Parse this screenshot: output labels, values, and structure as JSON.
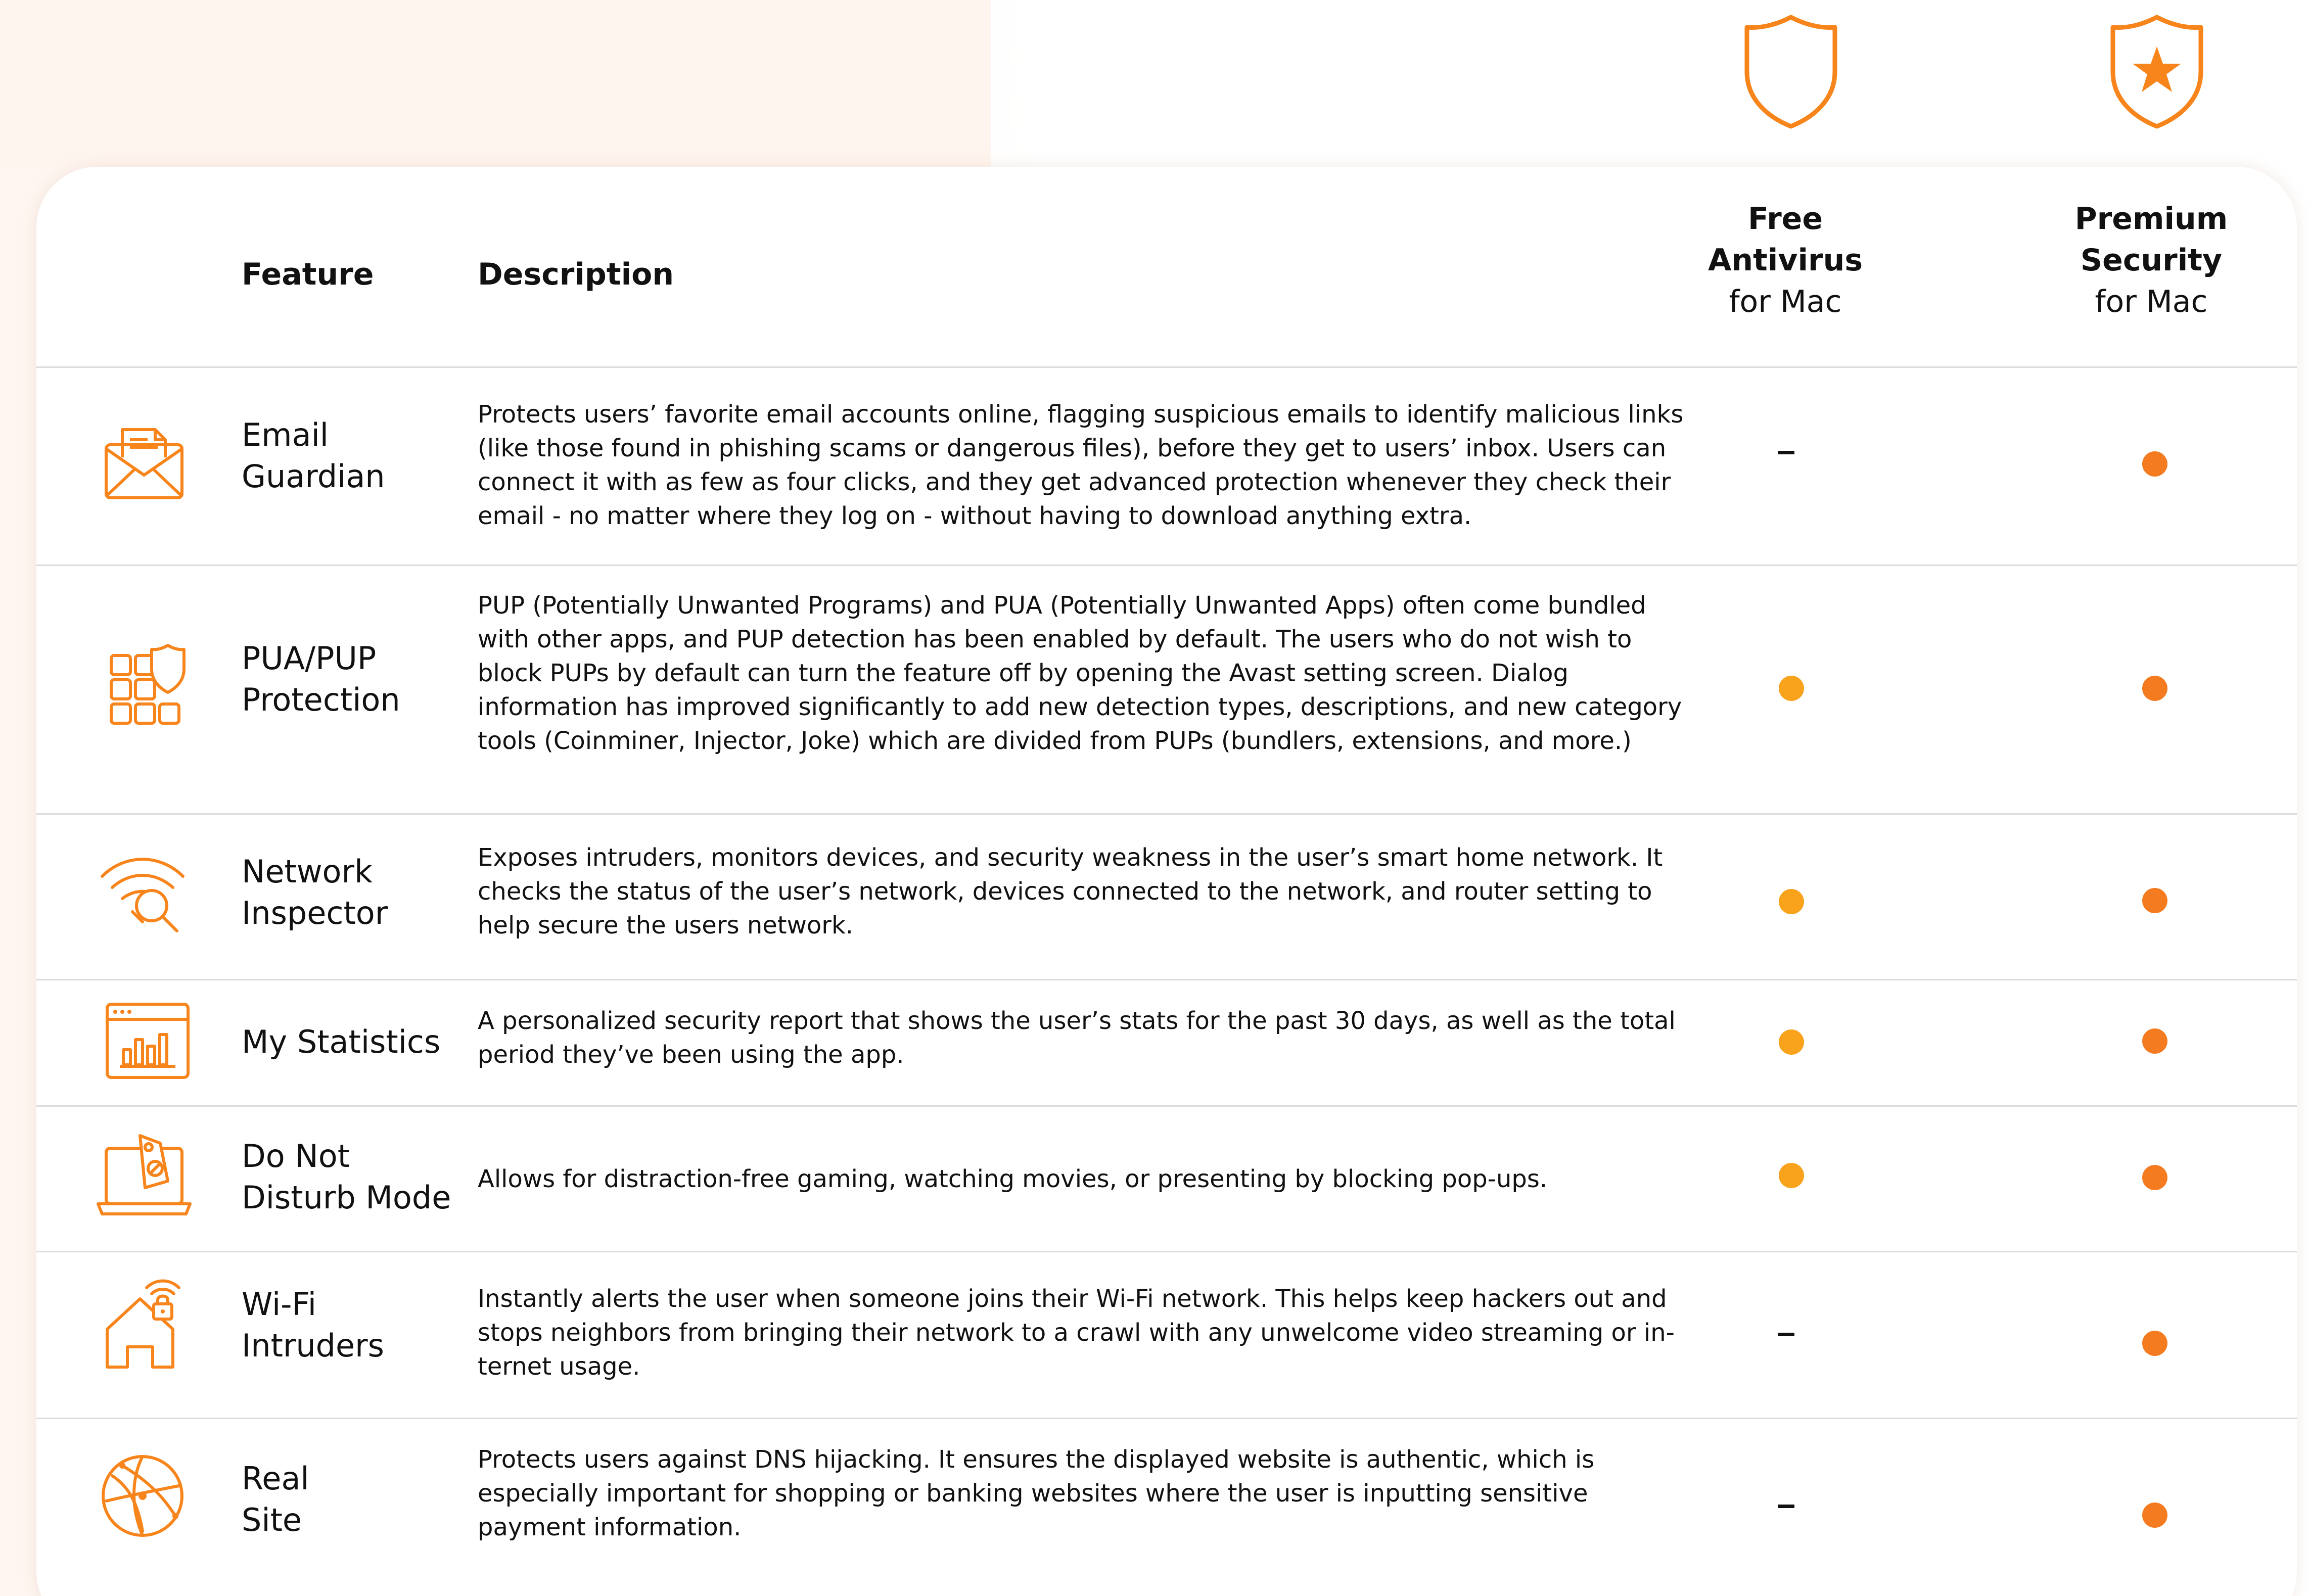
{
  "colors": {
    "accent": "#f7851b",
    "free_dot": "#f9a21c",
    "premium_dot": "#f47b20",
    "text": "#111111",
    "divider": "#dcdcdc"
  },
  "plans": [
    {
      "icon": "shield-icon",
      "name_bold_1": "Free",
      "name_bold_2": "Antivirus",
      "suffix": "for Mac"
    },
    {
      "icon": "shield-star-icon",
      "name_bold_1": "Premium",
      "name_bold_2": "Security",
      "suffix": "for Mac"
    }
  ],
  "header": {
    "feature": "Feature",
    "description": "Description"
  },
  "rows": [
    {
      "icon": "envelope-icon",
      "name_line1": "Email",
      "name_line2": "Guardian",
      "description": "Protects users’ favorite email accounts online, flagging suspicious emails to identify malicious links (like those found in phishing scams or dangerous files), before they get to users’ inbox. Users can connect it with as few as four clicks, and they get advanced protection whenever they check their email - no matter where they log on - without having to download anything extra.",
      "free": "–",
      "premium": "dot"
    },
    {
      "icon": "app-grid-shield-icon",
      "name_line1": "PUA/PUP",
      "name_line2": "Protection",
      "description": "PUP (Potentially Unwanted Programs) and PUA (Potentially Unwanted Apps) often come bundled with other apps, and PUP detection has been enabled by default. The users who do not wish to block PUPs by default can turn the feature off by opening the Avast setting screen. Dialog information has improved significantly to add new detection types, descriptions, and new category tools (Coinminer, Injector, Joke) which are divided from PUPs (bundlers, extensions, and more.)",
      "free": "dot",
      "premium": "dot"
    },
    {
      "icon": "wifi-magnifier-icon",
      "name_line1": "Network",
      "name_line2": "Inspector",
      "description": "Exposes intruders, monitors devices, and security weakness in the user’s smart home network. It checks the status of the user’s network, devices connected to the network, and router setting to help secure the users network.",
      "free": "dot",
      "premium": "dot"
    },
    {
      "icon": "statistics-window-icon",
      "name_line1": "My Statistics",
      "name_line2": "",
      "description": "A personalized security report that shows the user’s stats for the past 30 days, as well as the total period they’ve been using the app.",
      "free": "dot",
      "premium": "dot"
    },
    {
      "icon": "laptop-do-not-disturb-icon",
      "name_line1": "Do Not",
      "name_line2": "Disturb Mode",
      "description": "Allows for distraction-free gaming, watching movies, or presenting by blocking pop-ups.",
      "free": "dot",
      "premium": "dot"
    },
    {
      "icon": "house-lock-wifi-icon",
      "name_line1": "Wi-Fi",
      "name_line2": "Intruders",
      "description": "Instantly alerts the user when someone joins their Wi-Fi network. This helps keep hackers out and stops neighbors from bringing their network to a crawl with any unwelcome video streaming or in-ternet usage.",
      "free": "–",
      "premium": "dot"
    },
    {
      "icon": "globe-network-icon",
      "name_line1": "Real",
      "name_line2": "Site",
      "description": "Protects users against DNS hijacking. It ensures the displayed website is authentic, which is especially important for shopping or banking websites where the user is inputting sensitive payment information.",
      "free": "–",
      "premium": "dot"
    }
  ]
}
